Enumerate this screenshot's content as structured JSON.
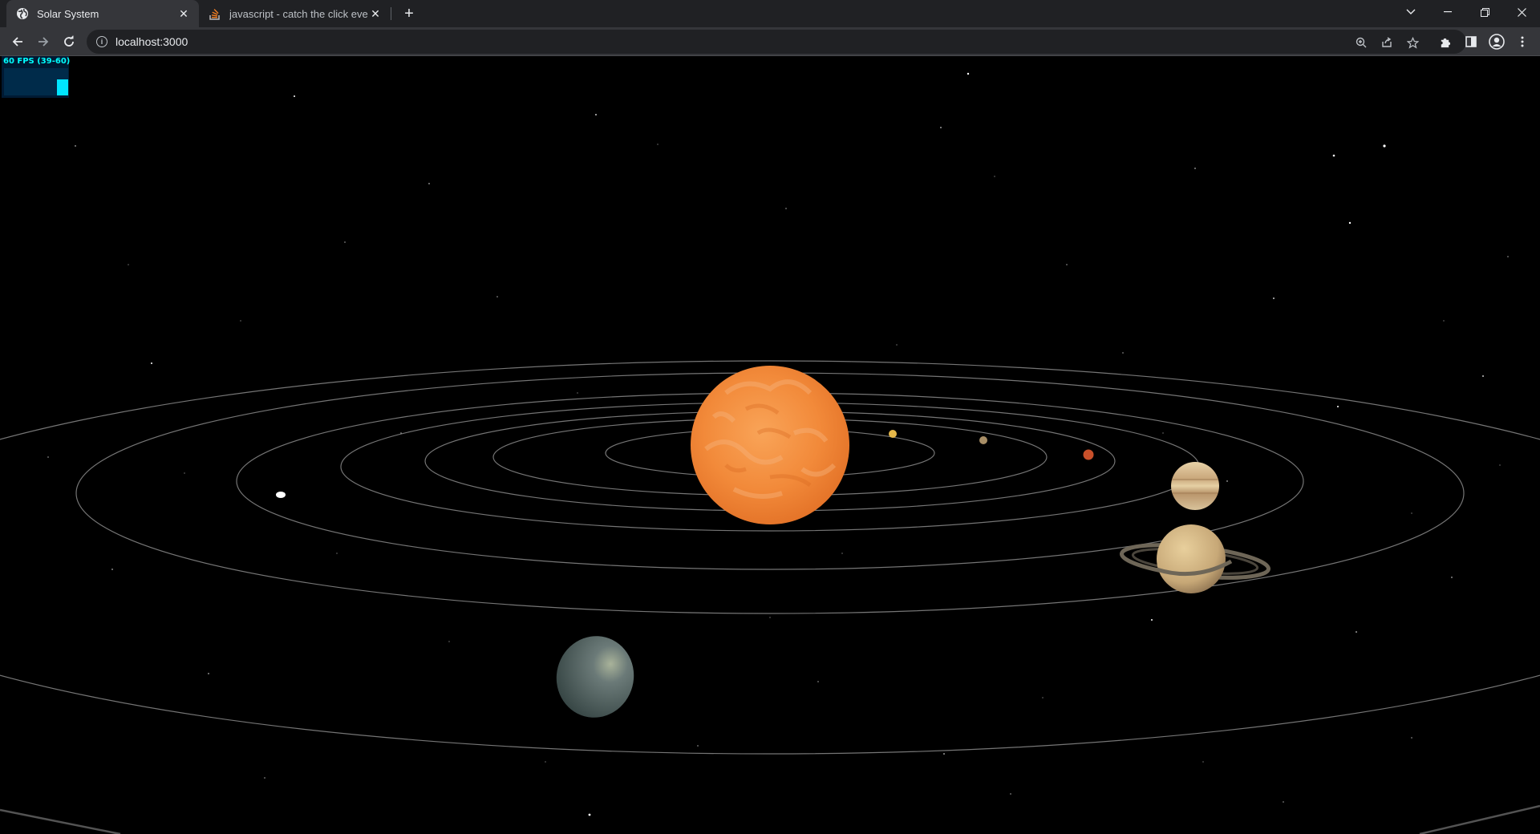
{
  "browser": {
    "tabs": [
      {
        "title": "Solar System",
        "active": true,
        "favicon": "globe-icon"
      },
      {
        "title": "javascript - catch the click event",
        "active": false,
        "favicon": "stackoverflow-icon"
      }
    ],
    "address": "localhost:3000"
  },
  "fps_meter": {
    "label": "60 FPS (39-60)",
    "fill_percent": 60
  },
  "colors": {
    "sun": "#f28a3a",
    "orbit": "#8a8a8a",
    "tab_bg": "#202124",
    "toolbar_bg": "#35363a"
  },
  "scene": {
    "bodies": [
      "sun",
      "mercury",
      "venus",
      "earth",
      "mars",
      "jupiter",
      "saturn",
      "uranus",
      "neptune"
    ]
  }
}
